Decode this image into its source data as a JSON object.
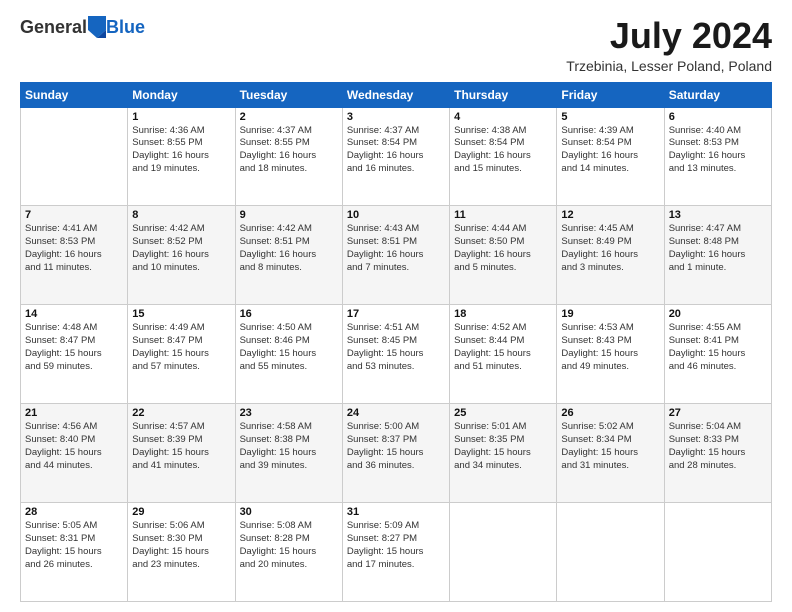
{
  "header": {
    "logo_general": "General",
    "logo_blue": "Blue",
    "title": "July 2024",
    "subtitle": "Trzebinia, Lesser Poland, Poland"
  },
  "columns": [
    "Sunday",
    "Monday",
    "Tuesday",
    "Wednesday",
    "Thursday",
    "Friday",
    "Saturday"
  ],
  "weeks": [
    [
      {
        "day": "",
        "text": ""
      },
      {
        "day": "1",
        "text": "Sunrise: 4:36 AM\nSunset: 8:55 PM\nDaylight: 16 hours\nand 19 minutes."
      },
      {
        "day": "2",
        "text": "Sunrise: 4:37 AM\nSunset: 8:55 PM\nDaylight: 16 hours\nand 18 minutes."
      },
      {
        "day": "3",
        "text": "Sunrise: 4:37 AM\nSunset: 8:54 PM\nDaylight: 16 hours\nand 16 minutes."
      },
      {
        "day": "4",
        "text": "Sunrise: 4:38 AM\nSunset: 8:54 PM\nDaylight: 16 hours\nand 15 minutes."
      },
      {
        "day": "5",
        "text": "Sunrise: 4:39 AM\nSunset: 8:54 PM\nDaylight: 16 hours\nand 14 minutes."
      },
      {
        "day": "6",
        "text": "Sunrise: 4:40 AM\nSunset: 8:53 PM\nDaylight: 16 hours\nand 13 minutes."
      }
    ],
    [
      {
        "day": "7",
        "text": "Sunrise: 4:41 AM\nSunset: 8:53 PM\nDaylight: 16 hours\nand 11 minutes."
      },
      {
        "day": "8",
        "text": "Sunrise: 4:42 AM\nSunset: 8:52 PM\nDaylight: 16 hours\nand 10 minutes."
      },
      {
        "day": "9",
        "text": "Sunrise: 4:42 AM\nSunset: 8:51 PM\nDaylight: 16 hours\nand 8 minutes."
      },
      {
        "day": "10",
        "text": "Sunrise: 4:43 AM\nSunset: 8:51 PM\nDaylight: 16 hours\nand 7 minutes."
      },
      {
        "day": "11",
        "text": "Sunrise: 4:44 AM\nSunset: 8:50 PM\nDaylight: 16 hours\nand 5 minutes."
      },
      {
        "day": "12",
        "text": "Sunrise: 4:45 AM\nSunset: 8:49 PM\nDaylight: 16 hours\nand 3 minutes."
      },
      {
        "day": "13",
        "text": "Sunrise: 4:47 AM\nSunset: 8:48 PM\nDaylight: 16 hours\nand 1 minute."
      }
    ],
    [
      {
        "day": "14",
        "text": "Sunrise: 4:48 AM\nSunset: 8:47 PM\nDaylight: 15 hours\nand 59 minutes."
      },
      {
        "day": "15",
        "text": "Sunrise: 4:49 AM\nSunset: 8:47 PM\nDaylight: 15 hours\nand 57 minutes."
      },
      {
        "day": "16",
        "text": "Sunrise: 4:50 AM\nSunset: 8:46 PM\nDaylight: 15 hours\nand 55 minutes."
      },
      {
        "day": "17",
        "text": "Sunrise: 4:51 AM\nSunset: 8:45 PM\nDaylight: 15 hours\nand 53 minutes."
      },
      {
        "day": "18",
        "text": "Sunrise: 4:52 AM\nSunset: 8:44 PM\nDaylight: 15 hours\nand 51 minutes."
      },
      {
        "day": "19",
        "text": "Sunrise: 4:53 AM\nSunset: 8:43 PM\nDaylight: 15 hours\nand 49 minutes."
      },
      {
        "day": "20",
        "text": "Sunrise: 4:55 AM\nSunset: 8:41 PM\nDaylight: 15 hours\nand 46 minutes."
      }
    ],
    [
      {
        "day": "21",
        "text": "Sunrise: 4:56 AM\nSunset: 8:40 PM\nDaylight: 15 hours\nand 44 minutes."
      },
      {
        "day": "22",
        "text": "Sunrise: 4:57 AM\nSunset: 8:39 PM\nDaylight: 15 hours\nand 41 minutes."
      },
      {
        "day": "23",
        "text": "Sunrise: 4:58 AM\nSunset: 8:38 PM\nDaylight: 15 hours\nand 39 minutes."
      },
      {
        "day": "24",
        "text": "Sunrise: 5:00 AM\nSunset: 8:37 PM\nDaylight: 15 hours\nand 36 minutes."
      },
      {
        "day": "25",
        "text": "Sunrise: 5:01 AM\nSunset: 8:35 PM\nDaylight: 15 hours\nand 34 minutes."
      },
      {
        "day": "26",
        "text": "Sunrise: 5:02 AM\nSunset: 8:34 PM\nDaylight: 15 hours\nand 31 minutes."
      },
      {
        "day": "27",
        "text": "Sunrise: 5:04 AM\nSunset: 8:33 PM\nDaylight: 15 hours\nand 28 minutes."
      }
    ],
    [
      {
        "day": "28",
        "text": "Sunrise: 5:05 AM\nSunset: 8:31 PM\nDaylight: 15 hours\nand 26 minutes."
      },
      {
        "day": "29",
        "text": "Sunrise: 5:06 AM\nSunset: 8:30 PM\nDaylight: 15 hours\nand 23 minutes."
      },
      {
        "day": "30",
        "text": "Sunrise: 5:08 AM\nSunset: 8:28 PM\nDaylight: 15 hours\nand 20 minutes."
      },
      {
        "day": "31",
        "text": "Sunrise: 5:09 AM\nSunset: 8:27 PM\nDaylight: 15 hours\nand 17 minutes."
      },
      {
        "day": "",
        "text": ""
      },
      {
        "day": "",
        "text": ""
      },
      {
        "day": "",
        "text": ""
      }
    ]
  ]
}
